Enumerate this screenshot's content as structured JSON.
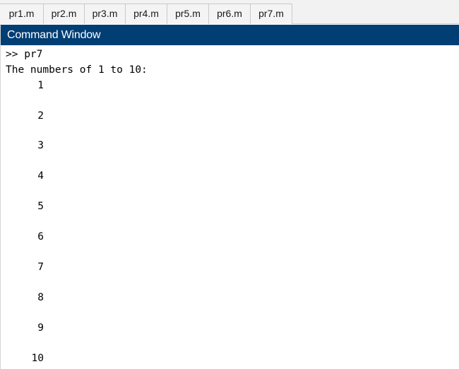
{
  "tabs": [
    {
      "label": "pr1.m"
    },
    {
      "label": "pr2.m"
    },
    {
      "label": "pr3.m"
    },
    {
      "label": "pr4.m"
    },
    {
      "label": "pr5.m"
    },
    {
      "label": "pr6.m"
    },
    {
      "label": "pr7.m"
    }
  ],
  "panel": {
    "title": "Command Window"
  },
  "console": {
    "prompt": ">> pr7",
    "header": "The numbers of 1 to 10:",
    "numbers": [
      "1",
      "2",
      "3",
      "4",
      "5",
      "6",
      "7",
      "8",
      "9",
      "10"
    ]
  },
  "colors": {
    "titlebar_bg": "#003e74",
    "titlebar_text": "#ffffff"
  }
}
